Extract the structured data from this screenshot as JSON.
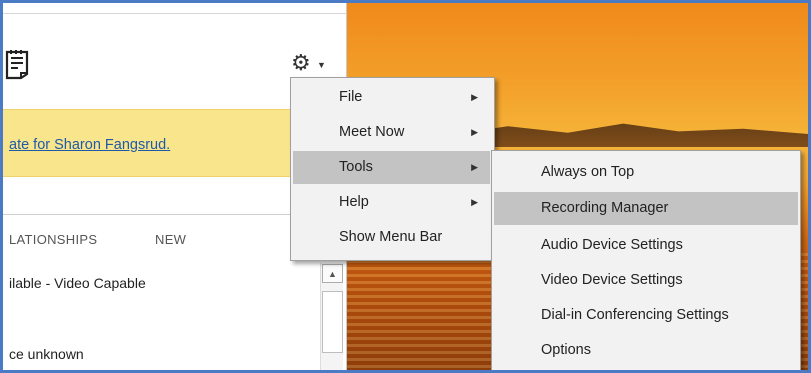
{
  "lync": {
    "banner_link": "ate for Sharon Fangsrud.",
    "tabs": [
      {
        "label": "LATIONSHIPS"
      },
      {
        "label": "NEW"
      }
    ],
    "contacts": [
      {
        "status": "ilable - Video Capable"
      },
      {
        "status": "ce unknown"
      }
    ]
  },
  "menu1": {
    "items": [
      {
        "label": "File",
        "has_submenu": true
      },
      {
        "label": "Meet Now",
        "has_submenu": true
      },
      {
        "label": "Tools",
        "has_submenu": true,
        "active": true
      },
      {
        "label": "Help",
        "has_submenu": true
      },
      {
        "label": "Show Menu Bar",
        "has_submenu": false
      }
    ]
  },
  "menu2": {
    "items": [
      {
        "label": "Always on Top"
      },
      {
        "label": "Recording Manager",
        "active": true
      },
      {
        "label": "Audio Device Settings"
      },
      {
        "label": "Video Device Settings"
      },
      {
        "label": "Dial-in Conferencing Settings"
      },
      {
        "label": "Options"
      }
    ]
  },
  "colors": {
    "frame_border": "#4a7bc4",
    "banner_bg": "#f9e58b",
    "link": "#1e5aa8",
    "menu_bg": "#f2f2f2",
    "menu_highlight": "#c3c3c3"
  }
}
